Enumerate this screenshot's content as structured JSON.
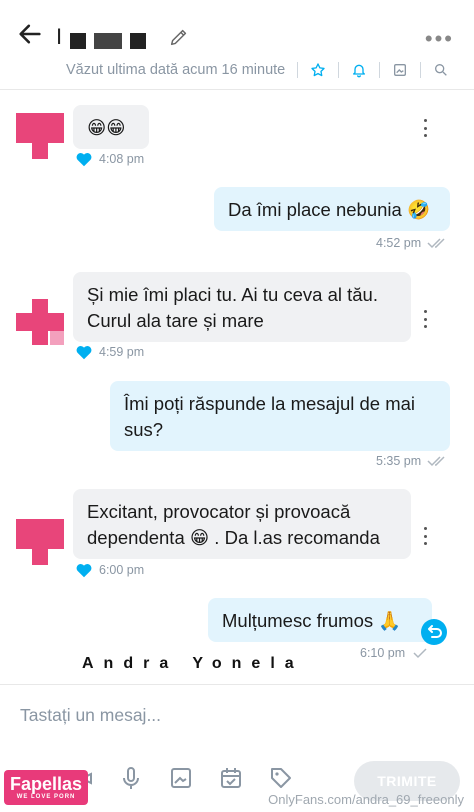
{
  "header": {
    "title_visible_char": "I",
    "last_seen": "Văzut ultima dată acum 16 minute",
    "more_label": "•••"
  },
  "messages": [
    {
      "dir": "in",
      "text": "😁😁",
      "time": "4:08 pm"
    },
    {
      "dir": "out",
      "text": "Da îmi place nebunia 🤣",
      "time": "4:52 pm"
    },
    {
      "dir": "in",
      "text_line1": "Și mie îmi placi tu. Ai tu ceva al tău.",
      "text_line2": "Curul ala tare și mare",
      "time": "4:59 pm"
    },
    {
      "dir": "out",
      "text_line1": "Îmi poți răspunde la mesajul de mai",
      "text_line2": "sus?",
      "time": "5:35 pm"
    },
    {
      "dir": "in",
      "text_line1": "Excitant, provocator și provoacă",
      "text_line2": "dependenta 😁 . Da l.as recomanda",
      "time": "6:00 pm"
    },
    {
      "dir": "out",
      "text": "Mulțumesc frumos 🙏",
      "time": "6:10 pm"
    }
  ],
  "signature": "Andra Yonela",
  "composer": {
    "placeholder": "Tastați un mesaj...",
    "send_label": "TRIMITE"
  },
  "watermark": {
    "brand": "Fapellas",
    "tagline": "WE LOVE PORN",
    "url": "OnlyFans.com/andra_69_freeonly"
  },
  "colors": {
    "accent": "#00aff0",
    "incoming_bubble": "#f0f1f3",
    "outgoing_bubble": "#e2f4fd",
    "avatar_pink": "#e8457a"
  }
}
